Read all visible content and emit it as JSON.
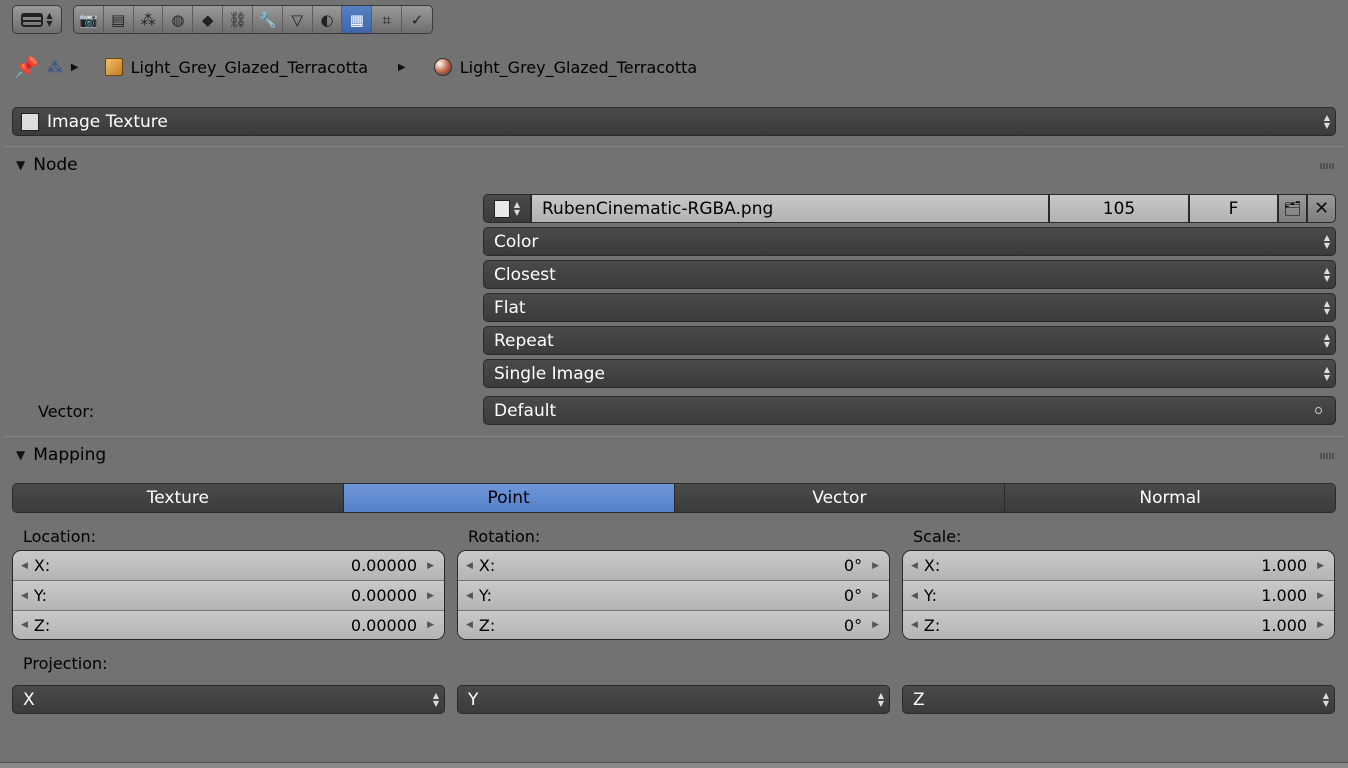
{
  "toolbar": {
    "editor_icon": "editor-type-icon",
    "tabs": [
      {
        "name": "render-icon",
        "glyph": "📷"
      },
      {
        "name": "render-layers-icon",
        "glyph": "▤"
      },
      {
        "name": "scene-icon",
        "glyph": "⁂"
      },
      {
        "name": "world-icon",
        "glyph": "◍"
      },
      {
        "name": "object-icon",
        "glyph": "◆"
      },
      {
        "name": "constraints-icon",
        "glyph": "⛓"
      },
      {
        "name": "modifiers-icon",
        "glyph": "🔧"
      },
      {
        "name": "data-icon",
        "glyph": "▽"
      },
      {
        "name": "material-icon",
        "glyph": "◐"
      },
      {
        "name": "texture-icon",
        "glyph": "▦"
      },
      {
        "name": "particles-icon",
        "glyph": "⌗"
      },
      {
        "name": "physics-icon",
        "glyph": "✓"
      }
    ],
    "active_tab": 9
  },
  "breadcrumb": {
    "object": "Light_Grey_Glazed_Terracotta",
    "material": "Light_Grey_Glazed_Terracotta"
  },
  "texture_type": "Image Texture",
  "node_panel": {
    "title": "Node",
    "image": {
      "filename": "RubenCinematic-RGBA.png",
      "users": "105",
      "fake": "F"
    },
    "color_space": "Color",
    "interpolation": "Closest",
    "projection": "Flat",
    "extension": "Repeat",
    "source": "Single Image",
    "vector_label": "Vector:",
    "vector_value": "Default"
  },
  "mapping_panel": {
    "title": "Mapping",
    "types": [
      "Texture",
      "Point",
      "Vector",
      "Normal"
    ],
    "active_type": 1,
    "location": {
      "label": "Location:",
      "x": "0.00000",
      "y": "0.00000",
      "z": "0.00000"
    },
    "rotation": {
      "label": "Rotation:",
      "x": "0°",
      "y": "0°",
      "z": "0°"
    },
    "scale": {
      "label": "Scale:",
      "x": "1.000",
      "y": "1.000",
      "z": "1.000"
    },
    "axis_labels": {
      "x": "X:",
      "y": "Y:",
      "z": "Z:"
    },
    "projection_label": "Projection:",
    "projection": [
      "X",
      "Y",
      "Z"
    ]
  }
}
